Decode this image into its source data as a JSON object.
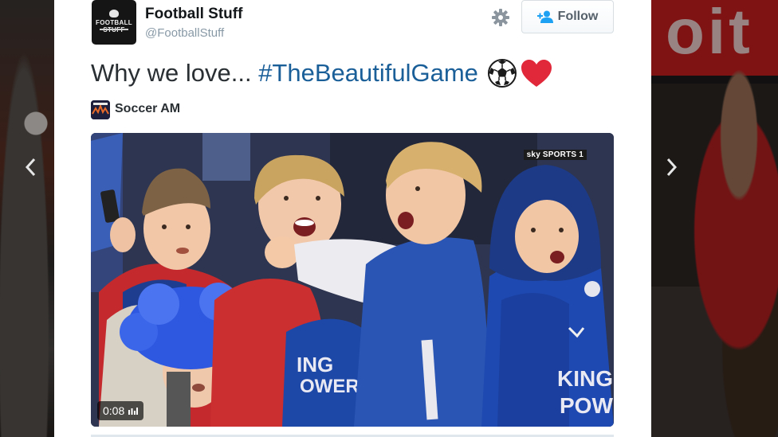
{
  "tweet": {
    "display_name": "Football Stuff",
    "handle": "@FootballStuff",
    "avatar_text": "FOOTBALL STUFF",
    "follow_label": "Follow",
    "text_plain": "Why we love... ",
    "hashtag": "#TheBeautifulGame",
    "source_name": "Soccer AM",
    "source_icon_text": "SOCCER AM"
  },
  "video": {
    "duration": "0:08",
    "channel_logo": "sky SPORTS 1",
    "kit_text_left": "KING POWER",
    "kit_text_right": "KING POWER"
  },
  "icons": {
    "settings": "gear-icon",
    "follow": "add-user-icon",
    "prev": "chevron-left-icon",
    "next": "chevron-right-icon",
    "soccer": "soccer-ball-emoji",
    "heart": "heart-emoji",
    "volume": "volume-bars-icon"
  },
  "colors": {
    "hashtag": "#1b5f99",
    "heart": "#e0283a",
    "leicester_blue": "#1f4fae"
  }
}
